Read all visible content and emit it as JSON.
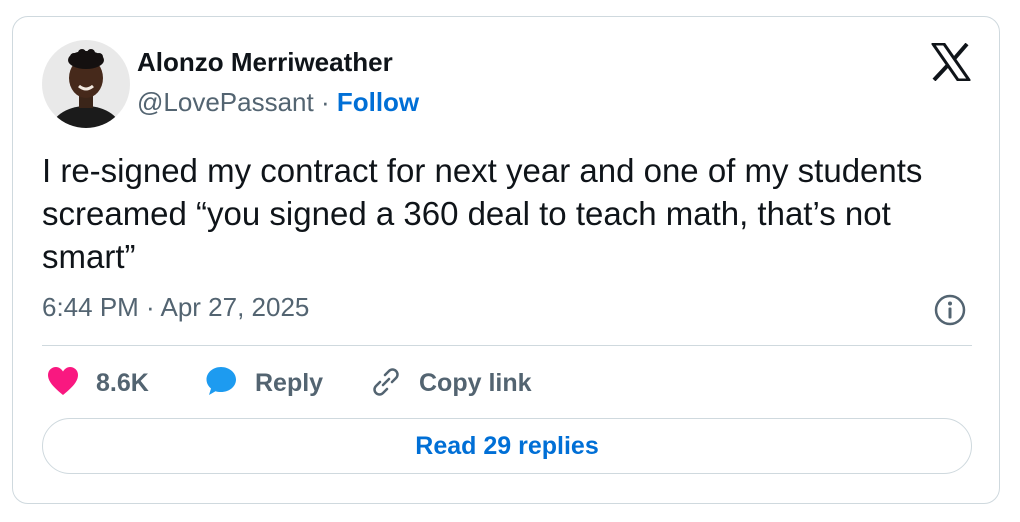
{
  "author": {
    "name": "Alonzo Merriweather",
    "handle": "@LovePassant",
    "separator": " · ",
    "follow_label": "Follow"
  },
  "tweet": {
    "text": "I re-signed my contract for next year and one of my students screamed “you signed a 360 deal to teach math, that’s not smart”",
    "timestamp": "6:44 PM · Apr 27, 2025"
  },
  "actions": {
    "like_count": "8.6K",
    "reply_label": "Reply",
    "copy_link_label": "Copy link"
  },
  "read_replies_label": "Read 29 replies",
  "colors": {
    "link_blue": "#006fd6",
    "like_pink": "#f91880",
    "reply_blue": "#1d9bf0",
    "secondary_text": "#536471",
    "primary_text": "#0f1419",
    "border": "#cfd9de"
  },
  "icons": [
    "x-logo-icon",
    "info-icon",
    "heart-icon",
    "speech-bubble-icon",
    "link-icon"
  ]
}
